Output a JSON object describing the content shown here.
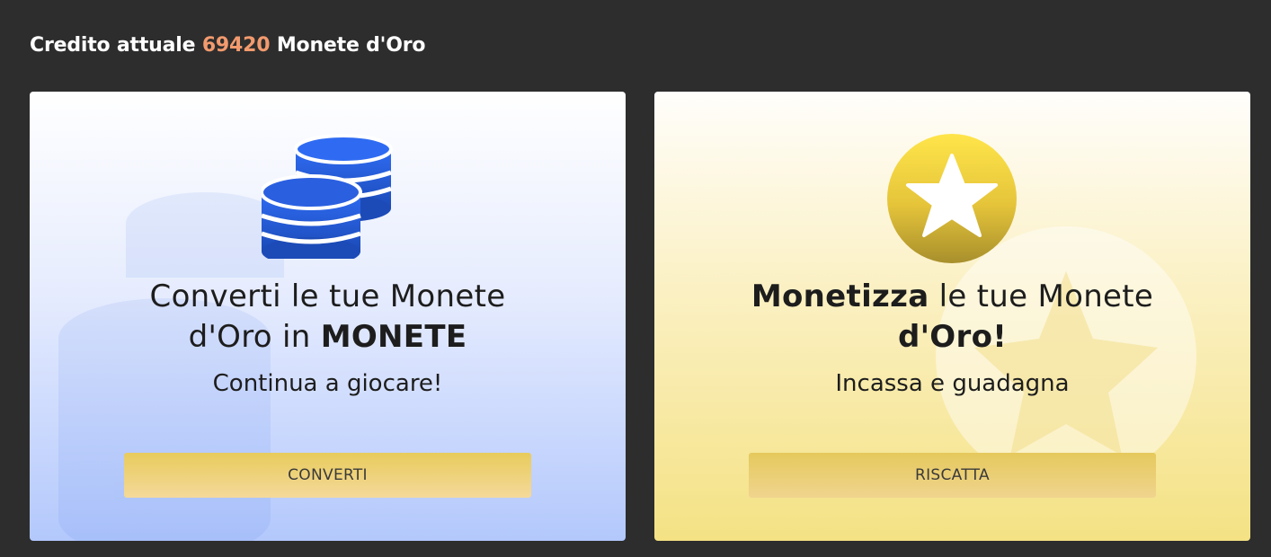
{
  "header": {
    "prefix": "Credito attuale",
    "amount": "69420",
    "suffix": "Monete d'Oro"
  },
  "cards": [
    {
      "icon": "coins-stack-icon",
      "title_part1": "Converti le tue Monete d'Oro in",
      "title_bold": "MONETE",
      "subtitle": "Continua a giocare!",
      "button_label": "CONVERTI"
    },
    {
      "icon": "gold-star-coin-icon",
      "title_bold": "Monetizza",
      "title_part2": "le tue Monete",
      "title_bold2": "d'Oro!",
      "subtitle": "Incassa e guadagna",
      "button_label": "RISCATTA"
    }
  ],
  "colors": {
    "background": "#2d2d2d",
    "amount": "#f29a6e",
    "coin_blue": "#2a5fe0",
    "button_gold": "#e8cb5c"
  }
}
